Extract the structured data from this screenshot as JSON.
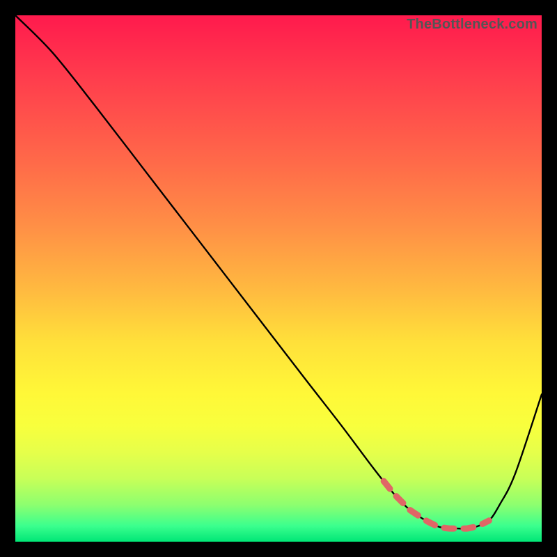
{
  "watermark": "TheBottleneck.com",
  "chart_data": {
    "type": "line",
    "title": "",
    "xlabel": "",
    "ylabel": "",
    "xlim": [
      0,
      100
    ],
    "ylim": [
      0,
      100
    ],
    "grid": false,
    "legend": false,
    "series": [
      {
        "name": "bottleneck-curve",
        "color": "#000000",
        "x": [
          0,
          7,
          15,
          25,
          35,
          45,
          55,
          62,
          68,
          72,
          75,
          78,
          80,
          82,
          84,
          86,
          88,
          90,
          92,
          95,
          100
        ],
        "y": [
          100,
          93,
          83,
          70,
          57,
          44,
          31,
          22,
          14,
          9,
          6,
          4,
          3,
          2.5,
          2.5,
          2.5,
          3,
          4,
          7,
          13,
          28
        ]
      }
    ],
    "dashed_region": {
      "name": "valley-dashes",
      "color": "#e06666",
      "x_range": [
        70,
        90
      ],
      "y_at": "curve"
    }
  }
}
